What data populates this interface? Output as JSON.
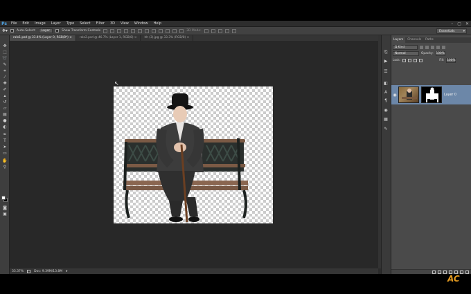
{
  "menubar": {
    "logo": "Ps",
    "items": [
      "File",
      "Edit",
      "Image",
      "Layer",
      "Type",
      "Select",
      "Filter",
      "3D",
      "View",
      "Window",
      "Help"
    ],
    "window_controls": [
      "–",
      "▢",
      "✕"
    ]
  },
  "options_bar": {
    "tool_icon": "move-tool-icon",
    "auto_select_label": "Auto-Select:",
    "auto_select_value": "Layer",
    "show_transform_label": "Show Transform Controls",
    "mode_3d_label": "3D Mode:",
    "workspace": "Essentials"
  },
  "tabs": [
    {
      "label": "rale1.psd @ 33.4% (Layer 0, RGB/8*) ×",
      "active": true
    },
    {
      "label": "rale2.psd @ 46.7% (Layer 1, RGB/8) ×",
      "active": false
    },
    {
      "label": "hh (3).jpg @ 33.3% (RGB/8) ×",
      "active": false
    }
  ],
  "status": {
    "zoom": "33.37%",
    "doc_info": "Doc: 9.39M/13.8M"
  },
  "layers_panel": {
    "tabs": [
      "Layers",
      "Channels",
      "Paths"
    ],
    "kind_filter": "Ω Kind",
    "blend_mode": "Normal",
    "opacity_label": "Opacity:",
    "opacity_value": "100%",
    "lock_label": "Lock:",
    "fill_label": "Fill:",
    "fill_value": "100%",
    "layer": {
      "name": "Layer 0",
      "visible": true
    }
  },
  "watermark": "AC",
  "colors": {
    "app_bg": "#2b2b2b",
    "canvas_bg": "#282828",
    "panel_bg": "#4a4a4a",
    "selected_layer": "#6c87a8",
    "ps_blue": "#4ea6e8"
  }
}
